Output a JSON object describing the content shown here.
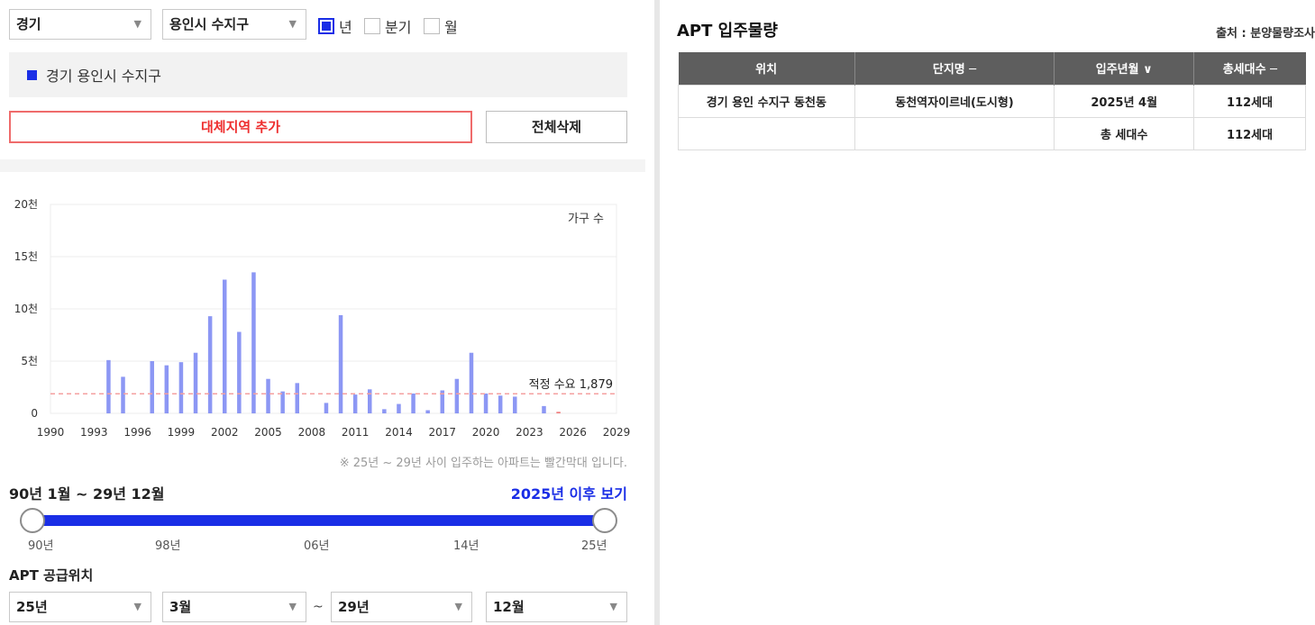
{
  "filters": {
    "province": "경기",
    "city": "용인시 수지구",
    "period_options": [
      {
        "label": "년",
        "checked": true
      },
      {
        "label": "분기",
        "checked": false
      },
      {
        "label": "월",
        "checked": false
      }
    ]
  },
  "region": {
    "label": "경기 용인시 수지구",
    "color": "#1a2ee6"
  },
  "buttons": {
    "add_alternative": "대체지역 추가",
    "delete_all": "전체삭제"
  },
  "chart_data": {
    "type": "bar",
    "ylabel": "가구 수",
    "ylim": [
      0,
      20000
    ],
    "yticks": [
      {
        "value": 0,
        "label": "0"
      },
      {
        "value": 5000,
        "label": "5천"
      },
      {
        "value": 10000,
        "label": "10천"
      },
      {
        "value": 15000,
        "label": "15천"
      },
      {
        "value": 20000,
        "label": "20천"
      }
    ],
    "xlim": [
      1990,
      2029
    ],
    "xticks": [
      1990,
      1993,
      1996,
      1999,
      2002,
      2005,
      2008,
      2011,
      2014,
      2017,
      2020,
      2023,
      2026,
      2029
    ],
    "x": [
      1994,
      1995,
      1997,
      1998,
      1999,
      2000,
      2001,
      2002,
      2003,
      2004,
      2005,
      2006,
      2007,
      2009,
      2010,
      2011,
      2012,
      2013,
      2014,
      2015,
      2016,
      2017,
      2018,
      2019,
      2020,
      2021,
      2022,
      2024,
      2025
    ],
    "values": [
      5100,
      3500,
      5000,
      4600,
      4900,
      5800,
      9300,
      12800,
      7800,
      13500,
      3300,
      2100,
      2900,
      1000,
      9400,
      1800,
      2300,
      400,
      900,
      1900,
      300,
      2200,
      3300,
      5800,
      1900,
      1700,
      1600,
      700,
      150
    ],
    "bar_color": "#8c97f4",
    "future_color": "#f08080",
    "future_from": 2025,
    "reference_line": {
      "value": 1879,
      "label": "적정 수요 1,879",
      "color": "#f4a0a0"
    },
    "grid": true
  },
  "chart_note": "※ 25년 ~ 29년 사이 입주하는 아파트는 빨간막대 입니다.",
  "range": {
    "label": "90년 1월 ~ 29년 12월",
    "after_link": "2025년 이후 보기",
    "tick_labels": [
      "90년",
      "98년",
      "06년",
      "14년",
      "25년"
    ]
  },
  "supply": {
    "title": "APT 공급위치",
    "start_year": "25년",
    "start_month": "3월",
    "end_year": "29년",
    "end_month": "12월",
    "separator": "~"
  },
  "apt": {
    "title": "APT 입주물량",
    "source": "출처 : 분양물량조사",
    "columns": [
      "위치",
      "단지명 ─",
      "입주년월 ∨",
      "총세대수 ─"
    ],
    "rows": [
      [
        "경기 용인 수지구 동천동",
        "동천역자이르네(도시형)",
        "2025년 4월",
        "112세대"
      ],
      [
        "",
        "",
        "총 세대수",
        "112세대"
      ]
    ]
  }
}
